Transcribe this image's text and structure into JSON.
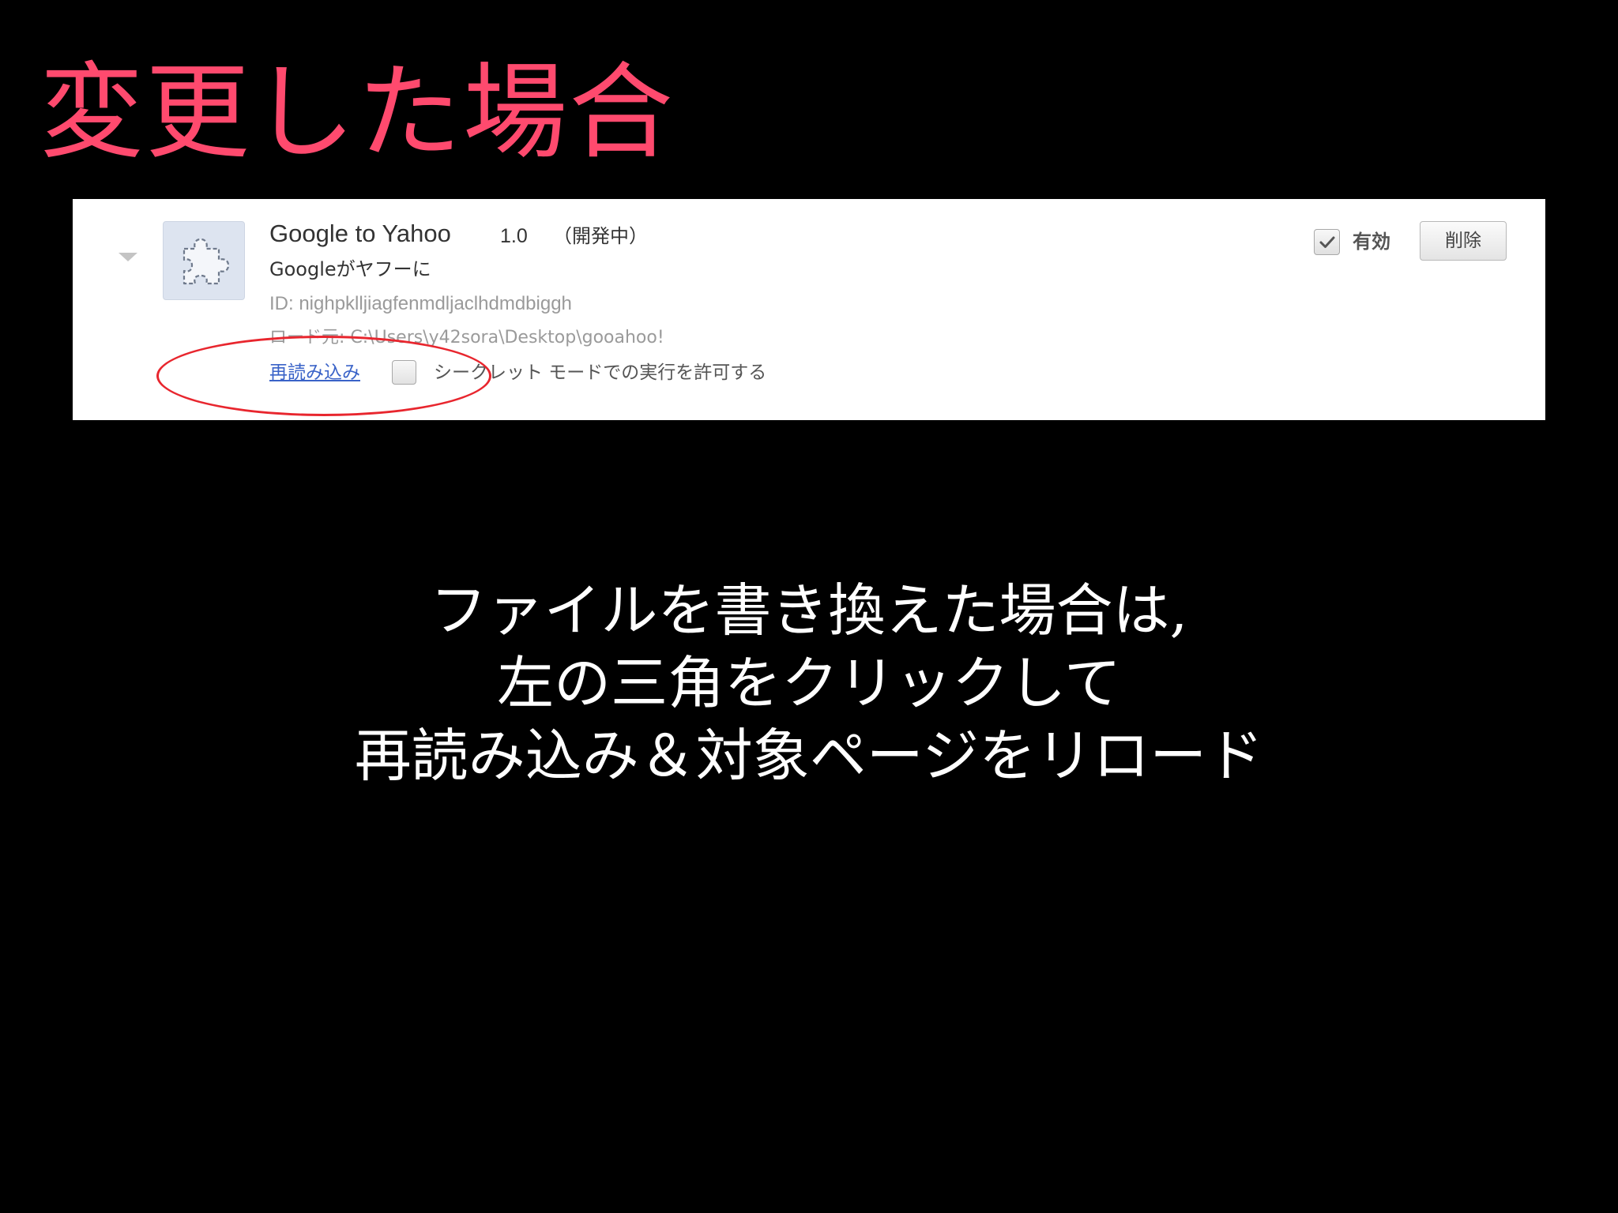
{
  "slide": {
    "title": "変更した場合",
    "body_lines": [
      "ファイルを書き換えた場合は,",
      "左の三角をクリックして",
      "再読み込み＆対象ページをリロード"
    ]
  },
  "extension": {
    "name": "Google to Yahoo",
    "version": "1.0",
    "status": "（開発中）",
    "description": "Googleがヤフーに",
    "id_text": "ID: nighpklljiagfenmdljaclhdmdbiggh",
    "load_path": "ロード元: C:\\Users\\y42sora\\Desktop\\gooahoo!",
    "reload_label": "再読み込み",
    "incognito_label": "シークレット モードでの実行を許可する",
    "incognito_checked": false,
    "enabled_label": "有効",
    "enabled_checked": true,
    "delete_label": "削除",
    "icon": "puzzle-piece-icon"
  },
  "colors": {
    "title": "#ff4a6e",
    "background": "#000000",
    "highlight": "#e8262e",
    "link": "#3a63c8"
  }
}
